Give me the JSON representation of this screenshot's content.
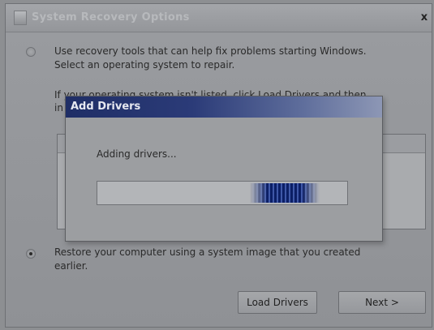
{
  "window": {
    "title": "System Recovery Options",
    "close_glyph": "x"
  },
  "option_repair": {
    "line1": "Use recovery tools that can help fix problems starting Windows.",
    "line2": "Select an operating system to repair.",
    "selected": false
  },
  "instructions": {
    "line1_visible": "If your operating system isn't listed, click Load Drivers and then",
    "line2_visible": "in"
  },
  "option_restore": {
    "line1": "Restore your computer using a system image that you created",
    "line2": "earlier.",
    "selected": true
  },
  "buttons": {
    "load_drivers": "Load Drivers",
    "next": "Next >"
  },
  "dialog": {
    "title": "Add Drivers",
    "status": "Adding drivers...",
    "progress_marquee_position": 0.75,
    "progress_marquee_width": 0.28
  },
  "colors": {
    "dialog_title_bar": "#1f2e66",
    "progress_fill": "#0c1f66"
  }
}
